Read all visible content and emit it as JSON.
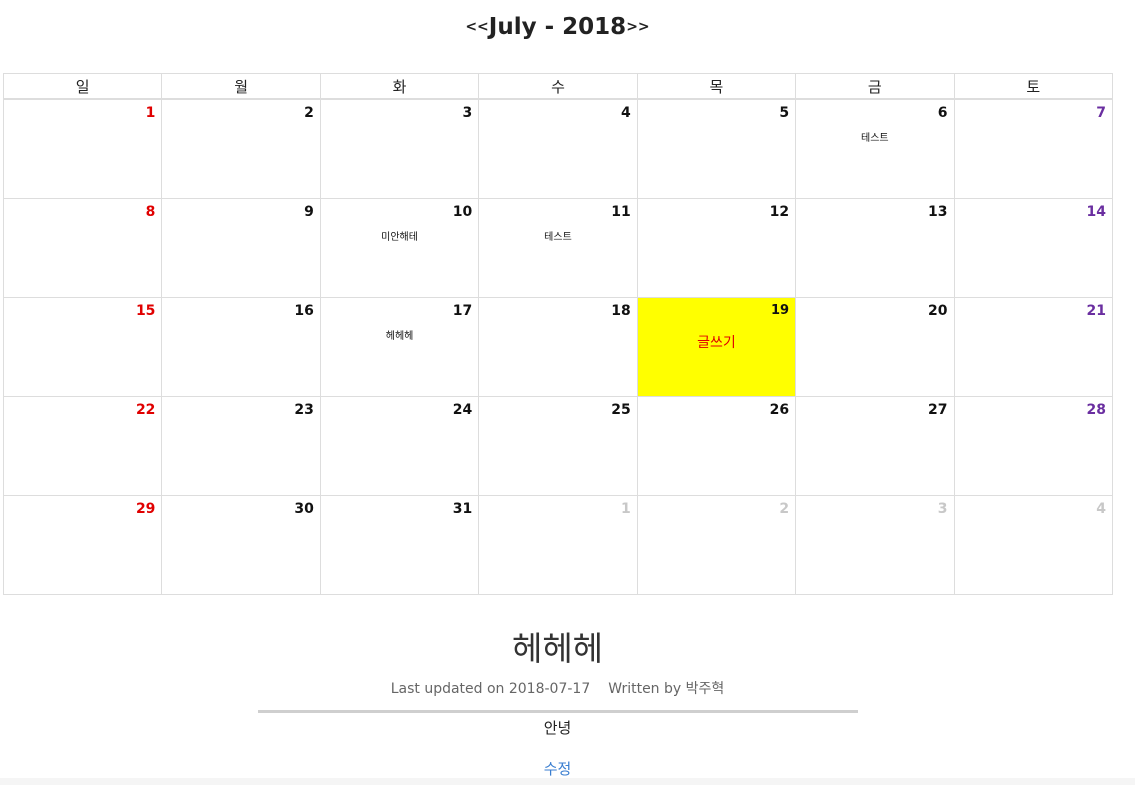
{
  "calendar": {
    "prev_label": "<<",
    "next_label": ">>",
    "title": "July - 2018",
    "weekdays": [
      "일",
      "월",
      "화",
      "수",
      "목",
      "금",
      "토"
    ],
    "weeks": [
      [
        {
          "day": "1",
          "type": "sun",
          "event": ""
        },
        {
          "day": "2",
          "type": "normal",
          "event": ""
        },
        {
          "day": "3",
          "type": "normal",
          "event": ""
        },
        {
          "day": "4",
          "type": "normal",
          "event": ""
        },
        {
          "day": "5",
          "type": "normal",
          "event": ""
        },
        {
          "day": "6",
          "type": "normal",
          "event": "테스트"
        },
        {
          "day": "7",
          "type": "sat",
          "event": ""
        }
      ],
      [
        {
          "day": "8",
          "type": "sun",
          "event": ""
        },
        {
          "day": "9",
          "type": "normal",
          "event": ""
        },
        {
          "day": "10",
          "type": "normal",
          "event": "미안해테"
        },
        {
          "day": "11",
          "type": "normal",
          "event": "테스트"
        },
        {
          "day": "12",
          "type": "normal",
          "event": ""
        },
        {
          "day": "13",
          "type": "normal",
          "event": ""
        },
        {
          "day": "14",
          "type": "sat",
          "event": ""
        }
      ],
      [
        {
          "day": "15",
          "type": "sun",
          "event": ""
        },
        {
          "day": "16",
          "type": "normal",
          "event": ""
        },
        {
          "day": "17",
          "type": "normal",
          "event": "헤헤헤"
        },
        {
          "day": "18",
          "type": "normal",
          "event": ""
        },
        {
          "day": "19",
          "type": "today",
          "event": "",
          "write": "글쓰기"
        },
        {
          "day": "20",
          "type": "normal",
          "event": ""
        },
        {
          "day": "21",
          "type": "sat",
          "event": ""
        }
      ],
      [
        {
          "day": "22",
          "type": "sun",
          "event": ""
        },
        {
          "day": "23",
          "type": "normal",
          "event": ""
        },
        {
          "day": "24",
          "type": "normal",
          "event": ""
        },
        {
          "day": "25",
          "type": "normal",
          "event": ""
        },
        {
          "day": "26",
          "type": "normal",
          "event": ""
        },
        {
          "day": "27",
          "type": "normal",
          "event": ""
        },
        {
          "day": "28",
          "type": "sat",
          "event": ""
        }
      ],
      [
        {
          "day": "29",
          "type": "sun",
          "event": ""
        },
        {
          "day": "30",
          "type": "normal",
          "event": ""
        },
        {
          "day": "31",
          "type": "normal",
          "event": ""
        },
        {
          "day": "1",
          "type": "other",
          "event": ""
        },
        {
          "day": "2",
          "type": "other",
          "event": ""
        },
        {
          "day": "3",
          "type": "other",
          "event": ""
        },
        {
          "day": "4",
          "type": "other",
          "event": ""
        }
      ]
    ],
    "colors": {
      "sunday": "#e00000",
      "saturday": "#6a2ea0",
      "today_bg": "#ffff00",
      "other_month": "#c8c8c8"
    }
  },
  "post": {
    "title": "헤헤헤",
    "updated": "Last updated on 2018-07-17",
    "author": "Written by 박주혁",
    "body": "안녕",
    "edit_label": "수정",
    "link_color": "#3a7ed0"
  }
}
